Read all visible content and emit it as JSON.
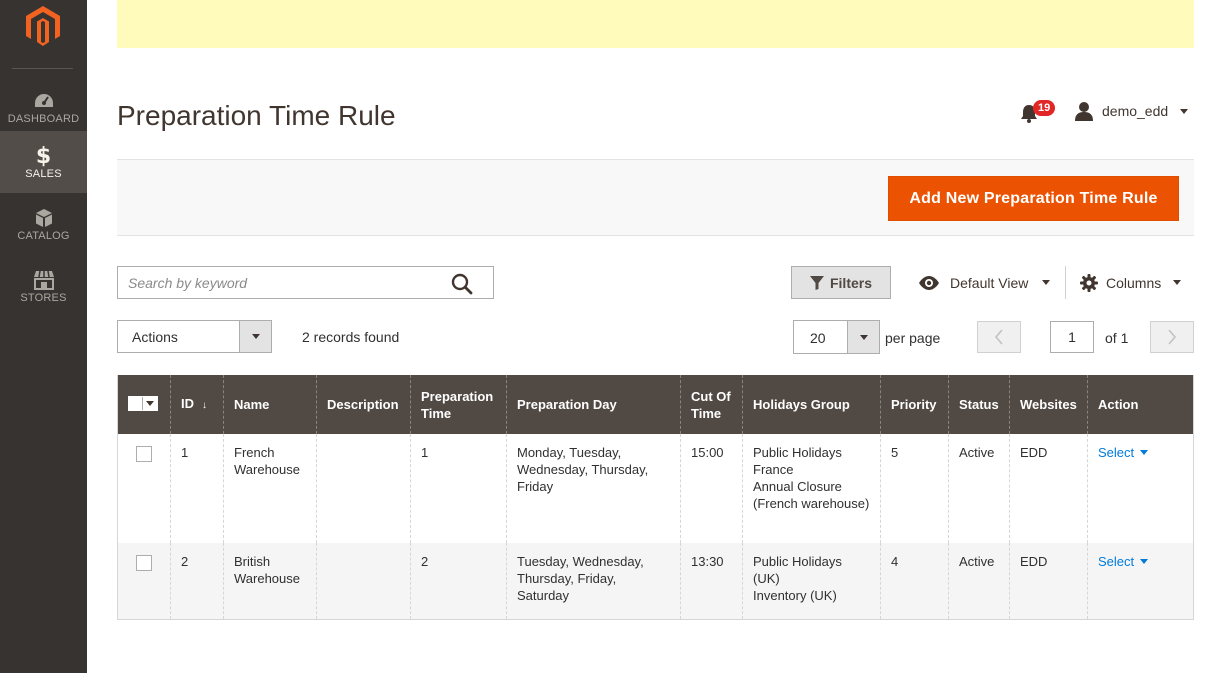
{
  "sidebar": {
    "items": [
      {
        "label": "DASHBOARD",
        "icon": "dashboard-icon"
      },
      {
        "label": "SALES",
        "icon": "dollar-icon"
      },
      {
        "label": "CATALOG",
        "icon": "box-icon"
      },
      {
        "label": "STORES",
        "icon": "store-icon"
      }
    ]
  },
  "header": {
    "title": "Preparation Time Rule",
    "notification_count": "19",
    "username": "demo_edd"
  },
  "action_bar": {
    "add_label": "Add New Preparation Time Rule"
  },
  "toolbar": {
    "search_placeholder": "Search by keyword",
    "filters_label": "Filters",
    "view_label": "Default View",
    "columns_label": "Columns",
    "actions_label": "Actions",
    "records_found": "2 records found",
    "per_page_value": "20",
    "per_page_label": "per page",
    "page_value": "1",
    "page_of": "of 1"
  },
  "grid": {
    "columns": {
      "id": "ID",
      "name": "Name",
      "description": "Description",
      "prep_time": "Preparation Time",
      "prep_day": "Preparation Day",
      "cutoff": "Cut Of Time",
      "holidays": "Holidays Group",
      "priority": "Priority",
      "status": "Status",
      "websites": "Websites",
      "action": "Action"
    },
    "rows": [
      {
        "id": "1",
        "name": "French Warehouse",
        "description": "",
        "prep_time": "1",
        "prep_day": "Monday, Tuesday, Wednesday, Thursday, Friday",
        "cutoff": "15:00",
        "holidays_1": "Public Holidays France",
        "holidays_2": "Annual Closure (French warehouse)",
        "priority": "5",
        "status": "Active",
        "websites": "EDD",
        "action": "Select"
      },
      {
        "id": "2",
        "name": "British Warehouse",
        "description": "",
        "prep_time": "2",
        "prep_day": "Tuesday, Wednesday, Thursday, Friday, Saturday",
        "cutoff": "13:30",
        "holidays_1": "Public Holidays (UK)",
        "holidays_2": "Inventory (UK)",
        "priority": "4",
        "status": "Active",
        "websites": "EDD",
        "action": "Select"
      }
    ]
  },
  "colors": {
    "sidebar_bg": "#373330",
    "accent": "#eb5202",
    "grid_header": "#514943",
    "link": "#007bdb",
    "notice_bg": "#fffbbb"
  }
}
